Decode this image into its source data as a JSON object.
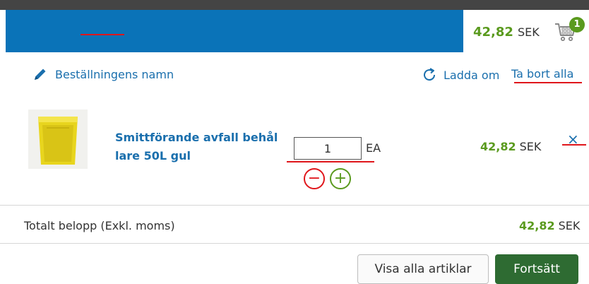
{
  "header": {
    "cart_amount": "42,82",
    "cart_currency": "SEK",
    "cart_count": "1",
    "icons": {
      "cart": "shopping-cart-icon"
    }
  },
  "toolbar": {
    "order_name_label": "Beställningens namn",
    "reload_label": "Ladda om",
    "remove_all_label": "Ta bort alla",
    "icons": {
      "order_name": "pencil-icon",
      "reload": "refresh-icon"
    }
  },
  "items": [
    {
      "name": "Smittförande avfall behållare 50L gul",
      "name_line1": "Smittförande avfall behål",
      "name_line2": "lare 50L gul",
      "quantity": "1",
      "unit": "EA",
      "price_amount": "42,82",
      "price_currency": "SEK",
      "remove_symbol": "×",
      "minus_symbol": "−",
      "plus_symbol": "+"
    }
  ],
  "summary": {
    "total_label": "Totalt belopp (Exkl. moms)",
    "total_amount": "42,82",
    "total_currency": "SEK"
  },
  "actions": {
    "view_all_label": "Visa alla artiklar",
    "continue_label": "Fortsätt"
  },
  "colors": {
    "header_blue": "#0a73b8",
    "link_blue": "#1a6fad",
    "price_green": "#5a9a1e",
    "continue_green": "#2e6b32",
    "remove_red": "#e0161b"
  }
}
